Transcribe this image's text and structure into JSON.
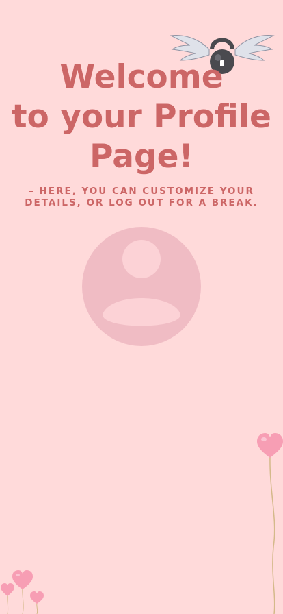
{
  "header": {
    "title_lines": [
      "Welcome",
      "to your Profile",
      "Page!"
    ],
    "subtitle_lines": [
      "– HERE, YOU CAN CUSTOMIZE YOUR",
      "DETAILS, OR LOG OUT FOR A BREAK."
    ]
  },
  "icons": {
    "logo": "winged-kettlebell-icon",
    "avatar": "user-avatar-placeholder-icon",
    "decor": "heart-balloon-icon"
  },
  "colors": {
    "background": "#ffdada",
    "title_text": "#cc6666",
    "avatar_circle": "#f0bcc4",
    "avatar_figure": "#fcd2d6",
    "balloon": "#f79eb4",
    "balloon_string": "#d4b98a"
  }
}
